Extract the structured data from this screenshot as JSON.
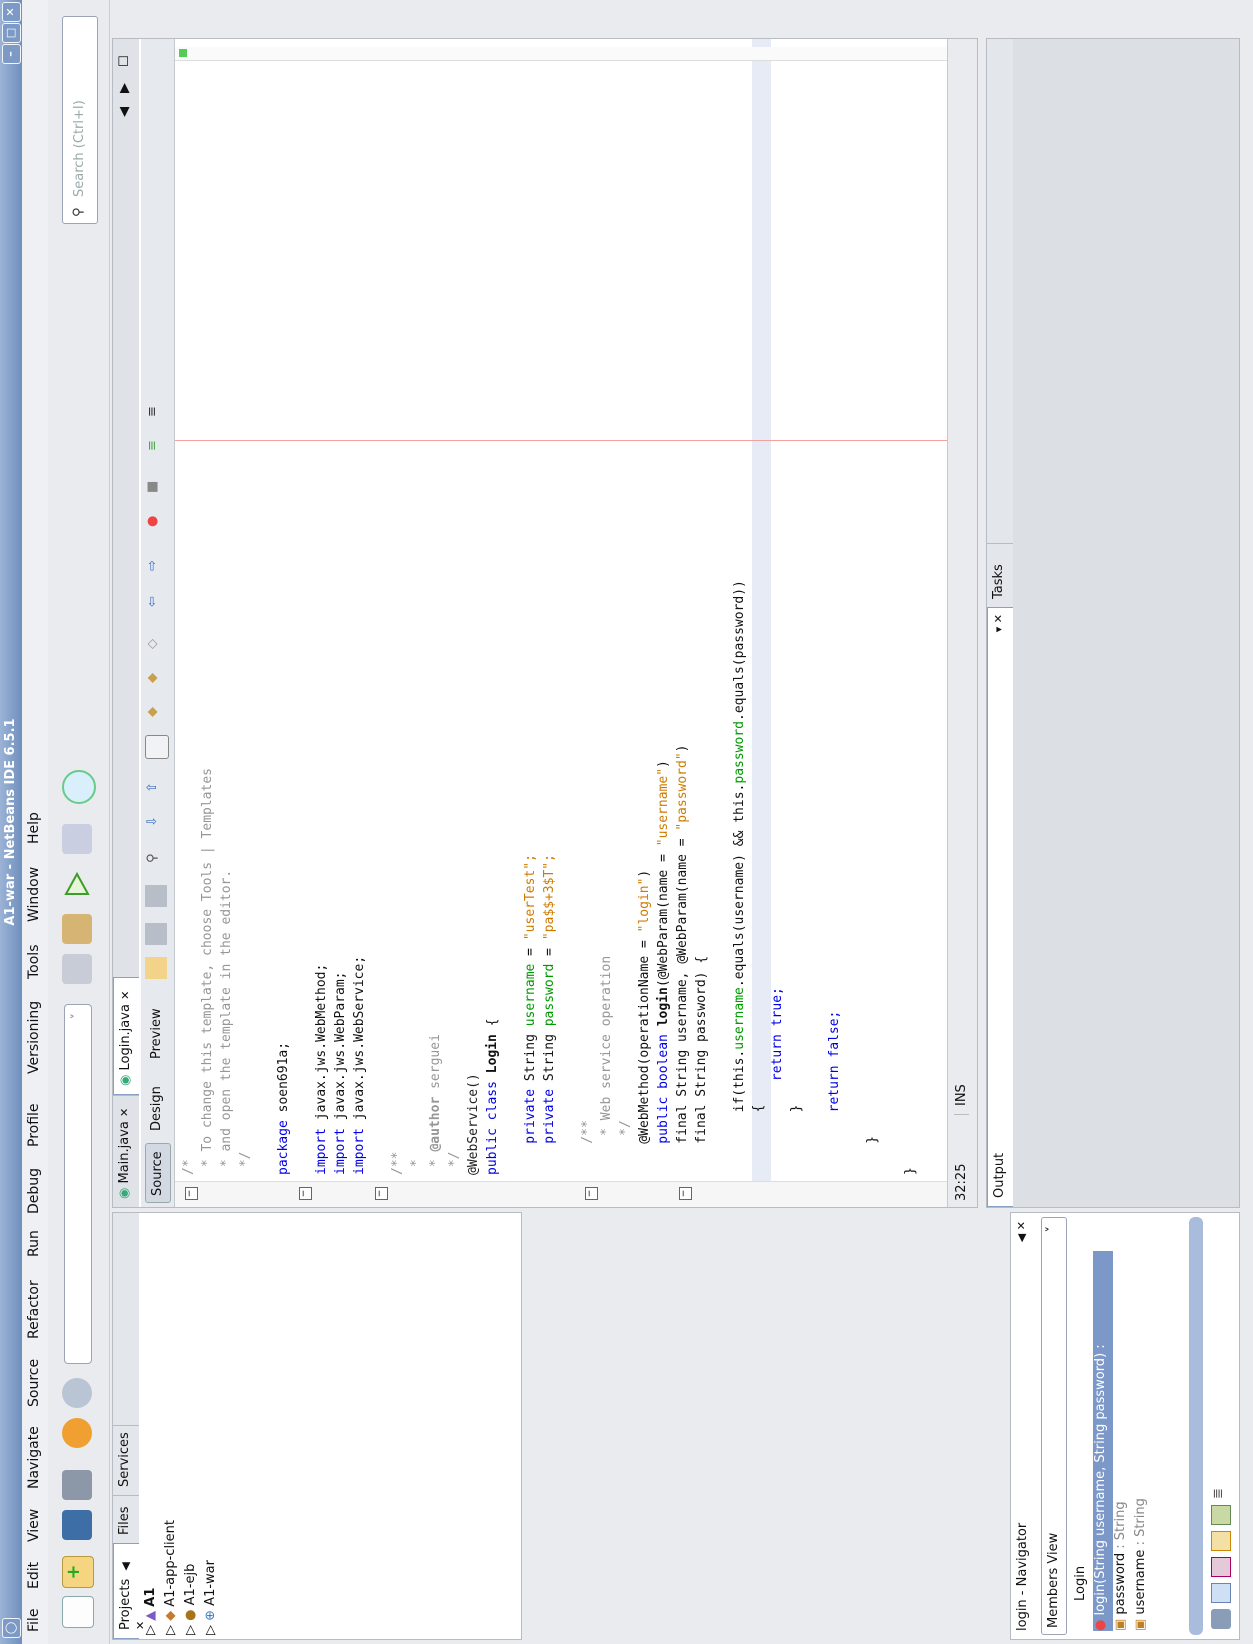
{
  "window": {
    "title": "A1-war - NetBeans IDE 6.5.1"
  },
  "menu": [
    "File",
    "Edit",
    "View",
    "Navigate",
    "Source",
    "Refactor",
    "Run",
    "Debug",
    "Profile",
    "Versioning",
    "Tools",
    "Window",
    "Help"
  ],
  "search": {
    "placeholder": "Search (Ctrl+I)"
  },
  "projects_panel": {
    "tabs": [
      "Projects",
      "Files",
      "Services"
    ],
    "tree": [
      "A1",
      "A1-app-client",
      "A1-ejb",
      "A1-war"
    ]
  },
  "navigator": {
    "title": "login - Navigator",
    "view": "Members View",
    "class_name": "Login",
    "items": [
      {
        "method": "login",
        "params": "(String username, String password) :"
      },
      {
        "name": "password",
        "type": " : String"
      },
      {
        "name": "username",
        "type": " : String"
      }
    ]
  },
  "editor": {
    "tabs": [
      "Main.java",
      "Login.java"
    ],
    "views": [
      "Source",
      "Design",
      "Preview"
    ],
    "status": {
      "position": "32:25",
      "mode": "INS"
    }
  },
  "code": {
    "c1": "/*",
    "c2": " * To change this template, choose Tools | Templates",
    "c3": " * and open the template in the editor.",
    "c4": " */",
    "pkg": "soen691a;",
    "imp1": "javax.jws.WebMethod;",
    "imp2": "javax.jws.WebParam;",
    "imp3": "javax.jws.WebService;",
    "d1": "/**",
    "d2": " *",
    "d3_tag": "@author",
    "d3_name": " serguei",
    "d4": " */",
    "ws": "@WebService()",
    "cls": "Login",
    "user_str": "\"userTest\";",
    "pass_str": "\"pa$$+3$T\";",
    "m1": "/**",
    "m2": " * Web service operation",
    "m3": " */",
    "wm_pre": "@WebMethod(operationName = ",
    "wm_str": "\"login\"",
    "wm_post": ")",
    "sig_name": "login",
    "sig_pre": "(@WebParam(name = ",
    "sig_str": "\"username\"",
    "sig_post": ")",
    "p1_pre": "final String username, @WebParam(name = ",
    "p1_str": "\"password\"",
    "p1_post": ")",
    "p2": "final String password) {",
    "if_a": "if(this.",
    "if_b": ".equals(username) && this.",
    "if_c": ".equals(password))",
    "ret_true": "true;",
    "ret_false": "false;"
  },
  "bottom": {
    "output": "Output",
    "tasks": "Tasks"
  }
}
